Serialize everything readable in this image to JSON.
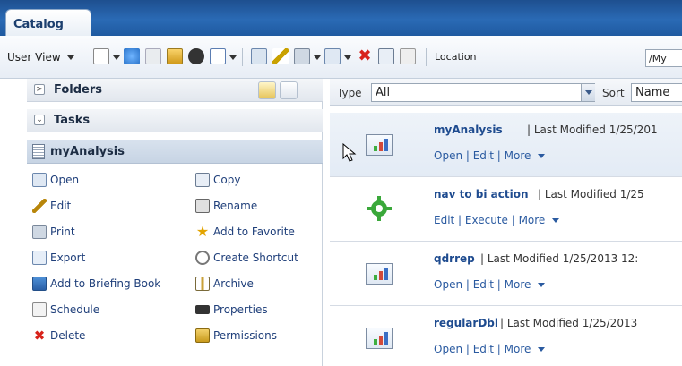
{
  "tab": {
    "title": "Catalog"
  },
  "toolbar": {
    "user_view": "User View",
    "location_label": "Location",
    "location_value": "/My"
  },
  "left": {
    "folders_label": "Folders",
    "tasks_label": "Tasks",
    "selected_item": "myAnalysis",
    "tasks_col1": [
      "Open",
      "Edit",
      "Print",
      "Export",
      "Add to Briefing Book",
      "Schedule",
      "Delete"
    ],
    "tasks_col2": [
      "Copy",
      "Rename",
      "Add to Favorite",
      "Create Shortcut",
      "Archive",
      "Properties",
      "Permissions"
    ]
  },
  "filter": {
    "type_label": "Type",
    "type_value": "All",
    "sort_label": "Sort",
    "sort_value": "Name"
  },
  "items": [
    {
      "name": "myAnalysis",
      "meta": "| Last Modified 1/25/201",
      "actions": "Open | Edit | More"
    },
    {
      "name": "nav to bi action",
      "meta": "| Last Modified 1/25",
      "actions": "Edit | Execute | More"
    },
    {
      "name": "qdrrep",
      "meta": "| Last Modified 1/25/2013 12:",
      "actions": "Open | Edit | More"
    },
    {
      "name": "regularDbl",
      "meta": "| Last Modified 1/25/2013",
      "actions": "Open | Edit | More"
    }
  ]
}
